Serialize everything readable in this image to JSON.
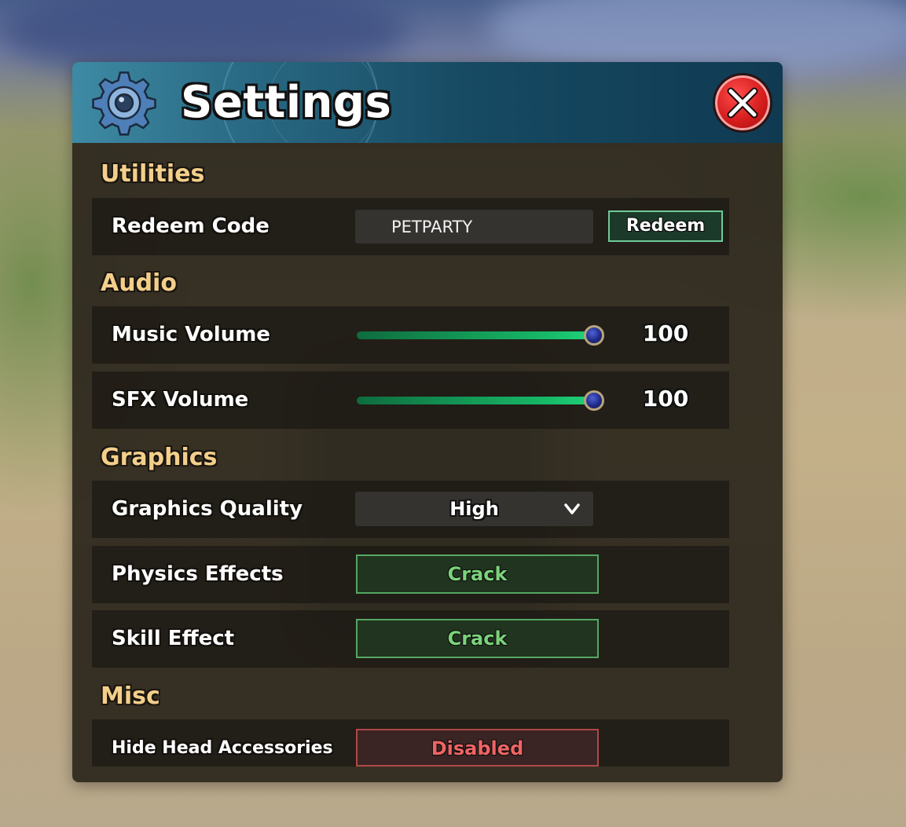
{
  "header": {
    "title": "Settings"
  },
  "sections": {
    "utilities": "Utilities",
    "audio": "Audio",
    "graphics": "Graphics",
    "misc": "Misc"
  },
  "redeem": {
    "label": "Redeem Code",
    "code_value": "PETPARTY",
    "button_label": "Redeem"
  },
  "music": {
    "label": "Music Volume",
    "value": "100",
    "fraction": 1.0
  },
  "sfx": {
    "label": "SFX Volume",
    "value": "100",
    "fraction": 1.0
  },
  "graphics_quality": {
    "label": "Graphics Quality",
    "selected": "High"
  },
  "physics_effects": {
    "label": "Physics Effects",
    "value": "Crack"
  },
  "skill_effect": {
    "label": "Skill Effect",
    "value": "Crack"
  },
  "hide_head_accessories": {
    "label": "Hide Head Accessories",
    "value": "Disabled"
  },
  "colors": {
    "section_title": "#f3cf8a",
    "toggle_on": "#7ad37a",
    "toggle_off": "#f06464",
    "slider_fill": "#17b968"
  },
  "icons": {
    "header": "gear-icon",
    "close": "close-icon",
    "dropdown": "chevron-down-icon"
  }
}
